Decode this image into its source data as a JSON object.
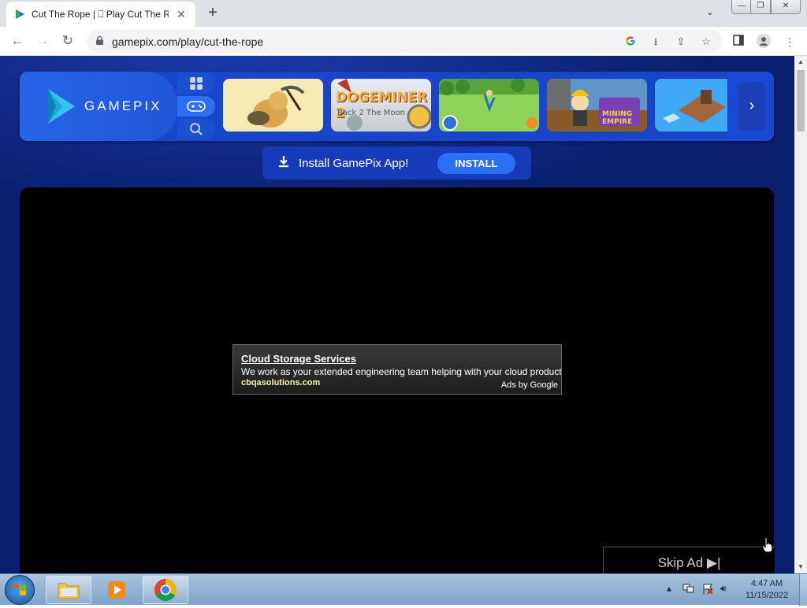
{
  "browser": {
    "tab": {
      "title": "Cut The Rope | ⎕ Play Cut The Ro",
      "close": "✕"
    },
    "new_tab": "+",
    "tab_search": "⌄",
    "window": {
      "minimize": "—",
      "maximize": "❐",
      "close": "✕"
    },
    "nav": {
      "back": "←",
      "forward": "→",
      "reload": "↻"
    },
    "url": "gamepix.com/play/cut-the-rope",
    "omni_icons": [
      "google-icon",
      "download-icon",
      "share-icon",
      "star-icon"
    ],
    "toolbar_icons": [
      "side-panel-icon",
      "profile-icon",
      "menu-icon"
    ]
  },
  "site": {
    "logo_text": "GAMEPIX",
    "games": [
      {
        "name": "doge-miner",
        "label": ""
      },
      {
        "name": "dogeminer-2",
        "label": "DOGEMINER 2",
        "sub": "Back 2 The Moon"
      },
      {
        "name": "green-field-game",
        "label": ""
      },
      {
        "name": "idle-mining-empire",
        "label": "MINING EMPIRE"
      },
      {
        "name": "island-raft-game",
        "label": ""
      }
    ],
    "install_text": "Install GamePix App!",
    "install_button": "INSTALL"
  },
  "ad": {
    "title": "Cloud Storage Services",
    "description": "We work as your extended engineering team helping with your cloud product",
    "url": "cbqasolutions.com",
    "by": "Ads by Google"
  },
  "skip_ad": "Skip Ad ▶|",
  "taskbar": {
    "time": "4:47 AM",
    "date": "11/15/2022",
    "tray_icons": [
      "show-hidden-icon",
      "network-icon",
      "action-center-icon",
      "volume-icon"
    ]
  },
  "colors": {
    "page_bg": "#0a1f6e",
    "accent": "#2b6ff5",
    "topbar": "#1845c9"
  }
}
